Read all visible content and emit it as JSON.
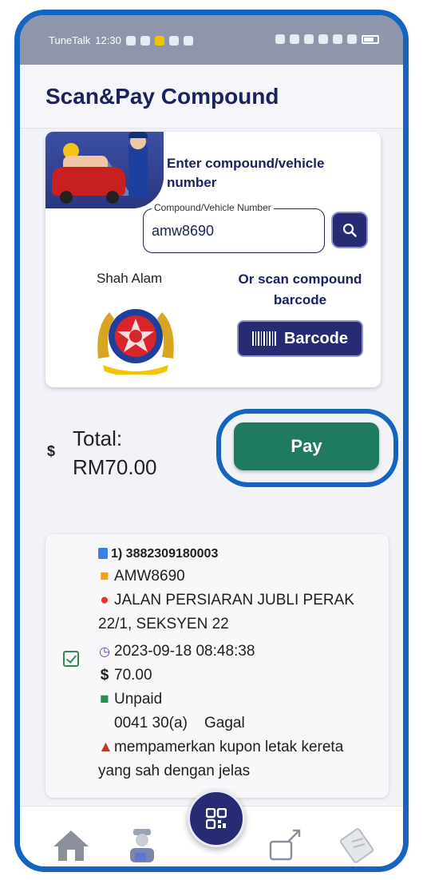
{
  "status_bar": {
    "carrier": "TuneTalk",
    "time": "12:30"
  },
  "header": {
    "title": "Scan&Pay Compound"
  },
  "lookup": {
    "instruction": "Enter compound/vehicle number",
    "field_label": "Compound/Vehicle Number",
    "field_value": "amw8690",
    "search_icon": "search-icon",
    "authority": "Shah Alam",
    "scan_instruction": "Or scan compound barcode",
    "barcode_button": "Barcode"
  },
  "total": {
    "currency_icon": "$",
    "label": "Total:",
    "value": "RM70.00",
    "pay_button": "Pay"
  },
  "compound": {
    "selected": true,
    "id": "1) 3882309180003",
    "plate": "AMW8690",
    "location": "JALAN PERSIARAN JUBLI PERAK 22/1, SEKSYEN 22",
    "datetime": "2023-09-18 08:48:38",
    "amount": "70.00",
    "status": "Unpaid",
    "code": "0041 30(a)    Gagal",
    "offence": "mempamerkan kupon letak kereta yang sah dengan jelas"
  },
  "nav": {
    "items": [
      "home-icon",
      "officer-icon",
      "qr-code-icon",
      "wallet-icon",
      "receipt-icon"
    ]
  },
  "colors": {
    "primary": "#262b73",
    "pay": "#1f7a62",
    "frame": "#1565c0"
  }
}
